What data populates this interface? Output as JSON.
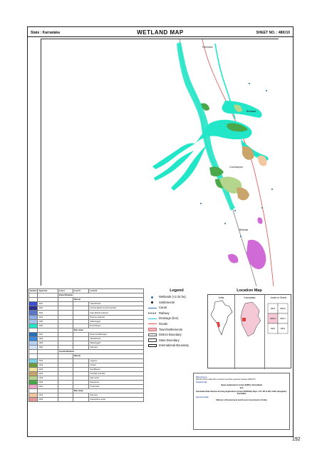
{
  "header": {
    "state": "State : Karnataka",
    "title": "WETLAND MAP",
    "sheet_no": "SHEET NO. : 48K/10"
  },
  "map": {
    "places": [
      "Honnavar",
      "Bhatkala",
      "Coondapura",
      "Belkude"
    ]
  },
  "classification_table": {
    "columns": [
      "Symbol",
      "Typecode",
      "Level I",
      "Level II",
      "Level III"
    ],
    "rows": [
      {
        "kind": "group",
        "level1": "Inland Wetlands"
      },
      {
        "kind": "subgroup",
        "level2": "Natural"
      },
      {
        "kind": "item",
        "code": "1101",
        "label": "Lakes/Ponds",
        "color": "#3a4fd0"
      },
      {
        "kind": "item",
        "code": "1102",
        "label": "Ox-bow lakes/ Cut-off meanders",
        "color": "#2b2f8a"
      },
      {
        "kind": "item",
        "code": "1103",
        "label": "High altitude wetlands",
        "color": "#5a77c9"
      },
      {
        "kind": "item",
        "code": "1104",
        "label": "Riverine wetlands",
        "color": "#8fb0e8"
      },
      {
        "kind": "item",
        "code": "1105",
        "label": "Waterlogged",
        "color": "#a6c6f0"
      },
      {
        "kind": "item",
        "code": "1106",
        "label": "River/Stream",
        "color": "#22e6c8"
      },
      {
        "kind": "subgroup",
        "level2": "Man-made"
      },
      {
        "kind": "item",
        "code": "1201",
        "label": "Reservoirs/Barrages",
        "color": "#2a6fb8"
      },
      {
        "kind": "item",
        "code": "1202",
        "label": "Tanks/Ponds",
        "color": "#3c8be0"
      },
      {
        "kind": "item",
        "code": "1203",
        "label": "Waterlogged",
        "color": "#b7d3f5"
      },
      {
        "kind": "item",
        "code": "1204",
        "label": "Salt pans",
        "color": "#d6e4f7"
      },
      {
        "kind": "group",
        "level1": "Coastal Wetlands"
      },
      {
        "kind": "subgroup",
        "level2": "Natural"
      },
      {
        "kind": "item",
        "code": "2101",
        "label": "Lagoons",
        "color": "#7fd4e8"
      },
      {
        "kind": "item",
        "code": "2102",
        "label": "Creeks",
        "color": "#6e9e3c"
      },
      {
        "kind": "item",
        "code": "2103",
        "label": "Sand/Beach",
        "color": "#f2e2a0"
      },
      {
        "kind": "item",
        "code": "2104",
        "label": "Intertidal mud flats",
        "color": "#c9a46b"
      },
      {
        "kind": "item",
        "code": "2105",
        "label": "Salt marsh",
        "color": "#b3d68c"
      },
      {
        "kind": "item",
        "code": "2106",
        "label": "Mangroves",
        "color": "#4aa84a"
      },
      {
        "kind": "item",
        "code": "2107",
        "label": "Coral reefs",
        "color": "#f0a7c8"
      },
      {
        "kind": "subgroup",
        "level2": "Man-made"
      },
      {
        "kind": "item",
        "code": "2201",
        "label": "Salt pans",
        "color": "#f3c7a0"
      },
      {
        "kind": "item",
        "code": "2202",
        "label": "Aquaculture ponds",
        "color": "#e29a9a"
      }
    ]
  },
  "legend": {
    "title": "Legend",
    "items": [
      {
        "label": "Wetlands (<2.25 ha)",
        "symbol": "dot-blue"
      },
      {
        "label": "Settlements",
        "symbol": "dot-black"
      },
      {
        "label": "Canal",
        "symbol": "line-blue"
      },
      {
        "label": "Railway",
        "symbol": "line-rail"
      },
      {
        "label": "Drainage (line)",
        "symbol": "line-cyan"
      },
      {
        "label": "Roads",
        "symbol": "line-red"
      },
      {
        "label": "Town/Settlements",
        "symbol": "fill-pink"
      },
      {
        "label": "District Boundary",
        "symbol": "box-thin"
      },
      {
        "label": "State Boundary",
        "symbol": "box-mid"
      },
      {
        "label": "International Boundary",
        "symbol": "box-thick"
      }
    ]
  },
  "location_map": {
    "title": "Location Map",
    "panes": [
      "India",
      "Karnataka",
      "Index to Sheet"
    ],
    "index_cells": [
      "48K/9",
      "48K/10",
      "48K/13",
      "48K/14",
      "48K/5",
      "48K/6"
    ]
  },
  "credits": {
    "data_source_label": "Data Source:",
    "data_source": "IRS P6 LISS III data (Pre-monsoon and Post-monsoon Season 2006-07)",
    "prepared_by_label": "Prepared By:",
    "prepared_by_1": "Space Applications Centre (ISRO), Ahmedabad",
    "and": "and",
    "prepared_by_2": "Karnataka State Remote Sensing Applications Centre (KSRSAC) Dept. of IT, BT & S&T, GOK, Bengaluru, Karnataka",
    "sponsored_by_label": "Sponsored By:",
    "sponsored_by": "Ministry of Environment and Forests Government of India"
  },
  "page_number": "192",
  "colors": {
    "river": "#22e6c8",
    "mangrove": "#4aa84a",
    "salt_marsh": "#b3d68c",
    "mudflat": "#c9a46b",
    "coral": "#d06ad6",
    "road": "#e05050",
    "frame": "#222222"
  }
}
